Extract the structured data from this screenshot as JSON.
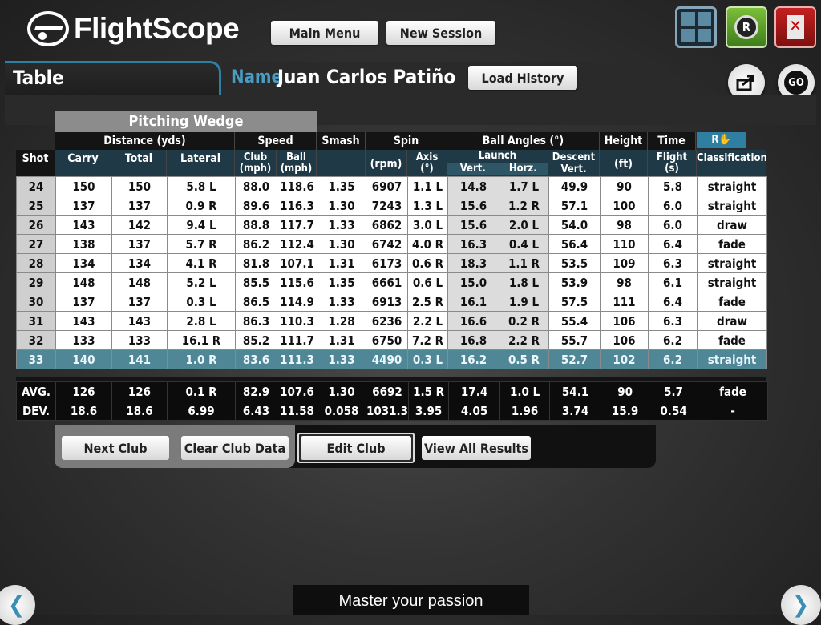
{
  "app": {
    "logo_text": "FlightScope",
    "main_menu_label": "Main Menu",
    "new_session_label": "New Session",
    "tab_title": "Table",
    "name_label": "Name",
    "player_name": "Juan Carlos Patiño",
    "load_history_label": "Load History",
    "go_label": "GO",
    "rec_label": "R",
    "footer_text": "Master your passion"
  },
  "table": {
    "club": "Pitching Wedge",
    "group_headers": {
      "distance": "Distance (yds)",
      "speed": "Speed",
      "smash": "Smash",
      "spin": "Spin",
      "ball_angles": "Ball Angles (°)",
      "height": "Height",
      "time": "Time",
      "rnd_flag": "R"
    },
    "columns": {
      "shot": "Shot",
      "carry": "Carry",
      "total": "Total",
      "lateral": "Lateral",
      "club": "Club",
      "club_unit": "(mph)",
      "ball": "Ball",
      "ball_unit": "(mph)",
      "rpm": "(rpm)",
      "axis": "Axis",
      "axis_unit": "(°)",
      "launch": "Launch",
      "launch_vert": "Vert.",
      "launch_horz": "Horz.",
      "descent": "Descent",
      "descent_sub": "Vert.",
      "height_unit": "(ft)",
      "flight": "Flight",
      "flight_unit": "(s)",
      "classification": "Classification"
    },
    "rows": [
      [
        "24",
        "150",
        "150",
        "5.8 L",
        "88.0",
        "118.6",
        "1.35",
        "6907",
        "1.1 L",
        "14.8",
        "1.7 L",
        "49.9",
        "90",
        "5.8",
        "straight"
      ],
      [
        "25",
        "137",
        "137",
        "0.9 R",
        "89.6",
        "116.3",
        "1.30",
        "7243",
        "1.3 L",
        "15.6",
        "1.2 R",
        "57.1",
        "100",
        "6.0",
        "straight"
      ],
      [
        "26",
        "143",
        "142",
        "9.4 L",
        "88.8",
        "117.7",
        "1.33",
        "6862",
        "3.0 L",
        "15.6",
        "2.0 L",
        "54.0",
        "98",
        "6.0",
        "draw"
      ],
      [
        "27",
        "138",
        "137",
        "5.7 R",
        "86.2",
        "112.4",
        "1.30",
        "6742",
        "4.0 R",
        "16.3",
        "0.4 L",
        "56.4",
        "110",
        "6.4",
        "fade"
      ],
      [
        "28",
        "134",
        "134",
        "4.1 R",
        "81.8",
        "107.1",
        "1.31",
        "6173",
        "0.6 R",
        "18.3",
        "1.1 R",
        "53.5",
        "109",
        "6.3",
        "straight"
      ],
      [
        "29",
        "148",
        "148",
        "5.2 L",
        "85.5",
        "115.6",
        "1.35",
        "6661",
        "0.6 L",
        "15.0",
        "1.8 L",
        "53.9",
        "98",
        "6.1",
        "straight"
      ],
      [
        "30",
        "137",
        "137",
        "0.3 L",
        "86.5",
        "114.9",
        "1.33",
        "6913",
        "2.5 R",
        "16.1",
        "1.9 L",
        "57.5",
        "111",
        "6.4",
        "fade"
      ],
      [
        "31",
        "143",
        "143",
        "2.8 L",
        "86.3",
        "110.3",
        "1.28",
        "6236",
        "2.2 L",
        "16.6",
        "0.2 R",
        "55.4",
        "106",
        "6.3",
        "draw"
      ],
      [
        "32",
        "133",
        "133",
        "16.1 R",
        "85.2",
        "111.7",
        "1.31",
        "6750",
        "7.2 R",
        "16.8",
        "2.2 R",
        "55.7",
        "106",
        "6.2",
        "fade"
      ],
      [
        "33",
        "140",
        "141",
        "1.0 R",
        "83.6",
        "111.3",
        "1.33",
        "4490",
        "0.3 L",
        "16.2",
        "0.5 R",
        "52.7",
        "102",
        "6.2",
        "straight"
      ]
    ],
    "highlight_shot": "33",
    "summary": [
      [
        "AVG.",
        "126",
        "126",
        "0.1 R",
        "82.9",
        "107.6",
        "1.30",
        "6692",
        "1.5 R",
        "17.4",
        "1.0 L",
        "54.1",
        "90",
        "5.7",
        "fade"
      ],
      [
        "DEV.",
        "18.6",
        "18.6",
        "6.99",
        "6.43",
        "11.58",
        "0.058",
        "1031.3",
        "3.95",
        "4.05",
        "1.96",
        "3.74",
        "15.9",
        "0.54",
        "-"
      ]
    ]
  },
  "buttons": {
    "next_club": "Next Club",
    "clear_club_data": "Clear Club Data",
    "edit_club": "Edit Club",
    "view_all_results": "View All Results"
  },
  "colors": {
    "accent": "#2f7fa3",
    "highlight_row": "#4f8797"
  }
}
